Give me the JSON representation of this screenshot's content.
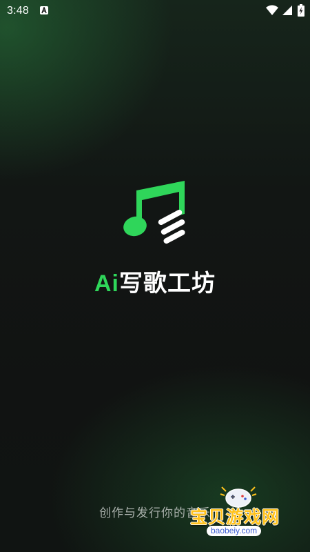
{
  "status_bar": {
    "time": "3:48"
  },
  "app": {
    "title_accent": "Ai",
    "title_rest": "写歌工坊",
    "tagline": "创作与发行你的音乐"
  },
  "watermark": {
    "brand": "宝贝游戏网",
    "url": "baobeiy.com"
  },
  "icons": {
    "logo": "music-note-icon",
    "notification": "android-a-icon",
    "wifi": "wifi-icon",
    "signal": "signal-icon",
    "battery": "battery-charging-icon"
  },
  "colors": {
    "accent": "#2fd65a",
    "background": "#121614",
    "watermark_text": "#ffc21c"
  }
}
